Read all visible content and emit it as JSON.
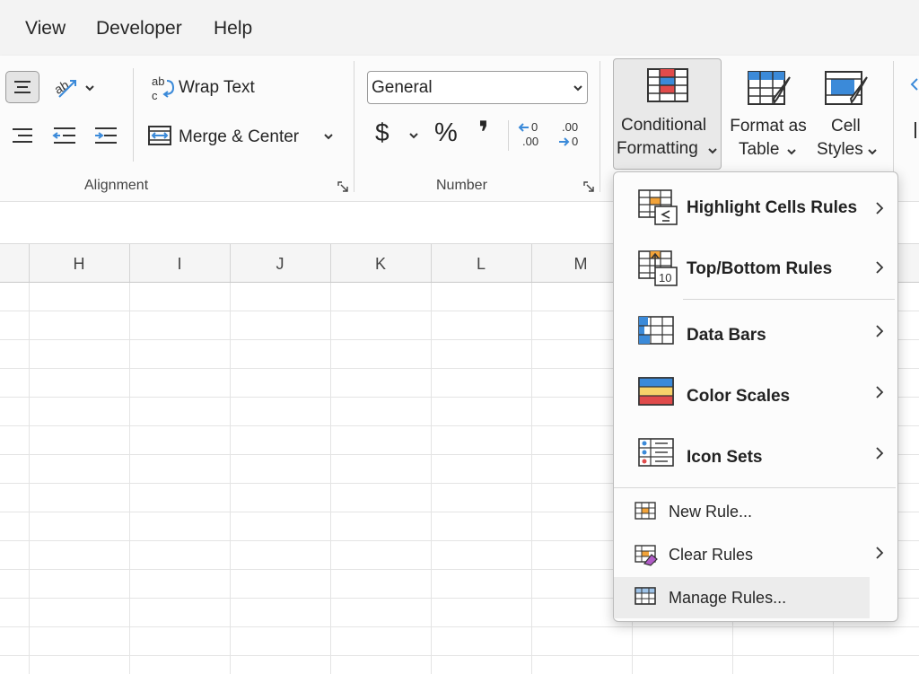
{
  "menu": {
    "tabs": [
      "View",
      "Developer",
      "Help"
    ]
  },
  "ribbon": {
    "alignment": {
      "label": "Alignment",
      "wrap_text": "Wrap Text",
      "merge_center": "Merge & Center"
    },
    "number": {
      "label": "Number",
      "format_value": "General",
      "currency_symbol": "$",
      "percent_symbol": "%",
      "comma_symbol": "❜"
    },
    "styles": {
      "conditional_formatting": {
        "line1": "Conditional",
        "line2": "Formatting"
      },
      "format_as_table": {
        "line1": "Format as",
        "line2": "Table"
      },
      "cell_styles": {
        "line1": "Cell",
        "line2": "Styles"
      }
    }
  },
  "sheet": {
    "columns": [
      "H",
      "I",
      "J",
      "K",
      "L",
      "M"
    ]
  },
  "cf_menu": {
    "items": [
      {
        "name": "highlight-cells-rules",
        "label": "Highlight Cells Rules",
        "submenu": true
      },
      {
        "name": "top-bottom-rules",
        "label": "Top/Bottom Rules",
        "submenu": true
      },
      {
        "name": "data-bars",
        "label": "Data Bars",
        "submenu": true
      },
      {
        "name": "color-scales",
        "label": "Color Scales",
        "submenu": true
      },
      {
        "name": "icon-sets",
        "label": "Icon Sets",
        "submenu": true
      },
      {
        "name": "new-rule",
        "label": "New Rule...",
        "submenu": false
      },
      {
        "name": "clear-rules",
        "label": "Clear Rules",
        "submenu": true
      },
      {
        "name": "manage-rules",
        "label": "Manage Rules...",
        "submenu": false
      }
    ],
    "top_bottom_icon_number": "10"
  },
  "colors": {
    "accent_blue": "#3b8ad9",
    "accent_red": "#e04b4b",
    "accent_orange": "#f2a33a",
    "accent_yellow": "#f7d36b",
    "menu_hover": "#ececec"
  }
}
